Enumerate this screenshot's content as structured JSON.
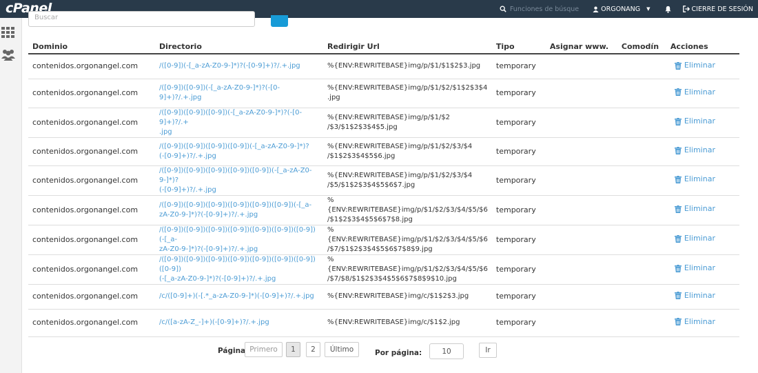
{
  "app": {
    "logo": "cPanel"
  },
  "topbar": {
    "search_placeholder": "Funciones de búsque",
    "username": "ORGONANG",
    "logout_label": "CIERRE DE SESIÓN"
  },
  "filter": {
    "search_placeholder": "Buscar"
  },
  "table": {
    "headers": {
      "domain": "Dominio",
      "directory": "Directorio",
      "redirect": "Redirigir Url",
      "type": "Tipo",
      "www": "Asignar www.",
      "wildcard": "Comodín",
      "actions": "Acciones"
    },
    "rows": [
      {
        "domain": "contenidos.orgonangel.com",
        "dir1": "/([0-9])(-[_a-zA-Z0-9-]*)?(-[0-9]+)?/.+.jpg",
        "dir2": "",
        "url1": "%{ENV:REWRITEBASE}img/p/$1/$1$2$3.jpg",
        "url2": "",
        "type": "temporary",
        "action": "Eliminar"
      },
      {
        "domain": "contenidos.orgonangel.com",
        "dir1": "/([0-9])([0-9])(-[_a-zA-Z0-9-]*)?(-[0-9]+)?/.+.jpg",
        "dir2": "",
        "url1": "%{ENV:REWRITEBASE}img/p/$1/$2/$1$2$3$4",
        "url2": ".jpg",
        "type": "temporary",
        "action": "Eliminar"
      },
      {
        "domain": "contenidos.orgonangel.com",
        "dir1": "/([0-9])([0-9])([0-9])(-[_a-zA-Z0-9-]*)?(-[0-9]+)?/.+",
        "dir2": ".jpg",
        "url1": "%{ENV:REWRITEBASE}img/p/$1/$2",
        "url2": "/$3/$1$2$3$4$5.jpg",
        "type": "temporary",
        "action": "Eliminar"
      },
      {
        "domain": "contenidos.orgonangel.com",
        "dir1": "/([0-9])([0-9])([0-9])([0-9])(-[_a-zA-Z0-9-]*)?",
        "dir2": "(-[0-9]+)?/.+.jpg",
        "url1": "%{ENV:REWRITEBASE}img/p/$1/$2/$3/$4",
        "url2": "/$1$2$3$4$5$6.jpg",
        "type": "temporary",
        "action": "Eliminar"
      },
      {
        "domain": "contenidos.orgonangel.com",
        "dir1": "/([0-9])([0-9])([0-9])([0-9])([0-9])(-[_a-zA-Z0-9-]*)?",
        "dir2": "(-[0-9]+)?/.+.jpg",
        "url1": "%{ENV:REWRITEBASE}img/p/$1/$2/$3/$4",
        "url2": "/$5/$1$2$3$4$5$6$7.jpg",
        "type": "temporary",
        "action": "Eliminar"
      },
      {
        "domain": "contenidos.orgonangel.com",
        "dir1": "/([0-9])([0-9])([0-9])([0-9])([0-9])([0-9])(-[_a-",
        "dir2": "zA-Z0-9-]*)?(-[0-9]+)?/.+.jpg",
        "url1": "%{ENV:REWRITEBASE}img/p/$1/$2/$3/$4/$5/$6",
        "url2": "/$1$2$3$4$5$6$7$8.jpg",
        "type": "temporary",
        "action": "Eliminar"
      },
      {
        "domain": "contenidos.orgonangel.com",
        "dir1": "/([0-9])([0-9])([0-9])([0-9])([0-9])([0-9])([0-9])(-[_a-",
        "dir2": "zA-Z0-9-]*)?(-[0-9]+)?/.+.jpg",
        "url1": "%{ENV:REWRITEBASE}img/p/$1/$2/$3/$4/$5/$6",
        "url2": "/$7/$1$2$3$4$5$6$7$8$9.jpg",
        "type": "temporary",
        "action": "Eliminar"
      },
      {
        "domain": "contenidos.orgonangel.com",
        "dir1": "/([0-9])([0-9])([0-9])([0-9])([0-9])([0-9])([0-9])([0-9])",
        "dir2": "(-[_a-zA-Z0-9-]*)?(-[0-9]+)?/.+.jpg",
        "url1": "%{ENV:REWRITEBASE}img/p/$1/$2/$3/$4/$5/$6",
        "url2": "/$7/$8/$1$2$3$4$5$6$7$8$9$10.jpg",
        "type": "temporary",
        "action": "Eliminar"
      },
      {
        "domain": "contenidos.orgonangel.com",
        "dir1": "/c/([0-9]+)(-[.*_a-zA-Z0-9-]*)(-[0-9]+)?/.+.jpg",
        "dir2": "",
        "url1": "%{ENV:REWRITEBASE}img/c/$1$2$3.jpg",
        "url2": "",
        "type": "temporary",
        "action": "Eliminar"
      },
      {
        "domain": "contenidos.orgonangel.com",
        "dir1": "/c/([a-zA-Z_-]+)(-[0-9]+)?/.+.jpg",
        "dir2": "",
        "url1": "%{ENV:REWRITEBASE}img/c/$1$2.jpg",
        "url2": "",
        "type": "temporary",
        "action": "Eliminar"
      }
    ]
  },
  "pagination": {
    "page_label": "Página:",
    "first": "Primero",
    "page1": "1",
    "page2": "2",
    "last": "Último",
    "per_page_label": "Por página:",
    "per_page_value": "10",
    "go": "Ir"
  },
  "colors": {
    "topbar": "#293a4a",
    "link": "#4a9bd4",
    "primary": "#179bd7"
  },
  "icons": [
    "search-icon",
    "user-icon",
    "bell-icon",
    "logout-icon",
    "grid-icon",
    "users-icon",
    "trash-icon"
  ]
}
